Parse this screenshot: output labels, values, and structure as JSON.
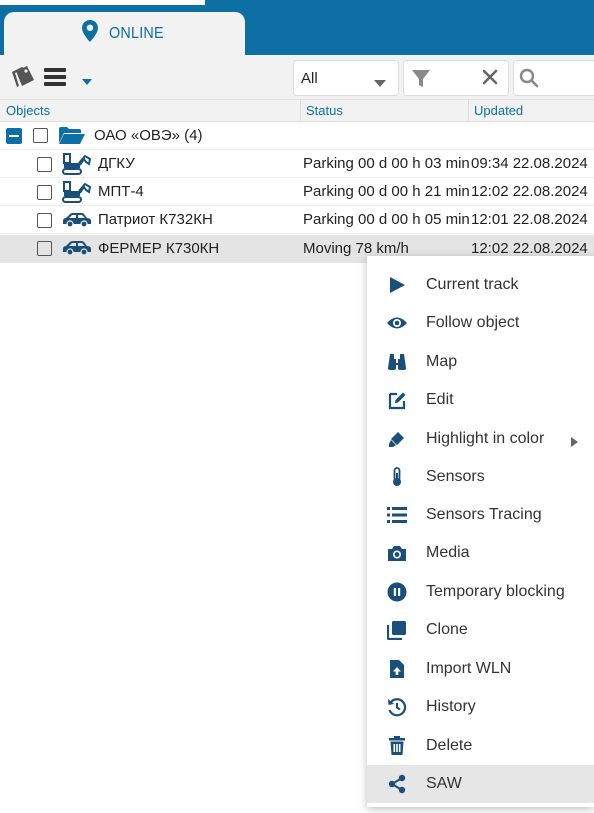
{
  "header": {
    "tab_label": "ONLINE"
  },
  "toolbar": {
    "select_value": "All",
    "search_placeholder": ""
  },
  "table": {
    "columns": {
      "objects": "Objects",
      "status": "Status",
      "updated": "Updated"
    },
    "group": {
      "label": "ОАО «ОВЭ» (4)"
    },
    "rows": [
      {
        "name": "ДГКУ",
        "status": "Parking 00 d 00 h 03 min",
        "updated": "09:34 22.08.2024",
        "icon": "excavator-icon"
      },
      {
        "name": "МПТ-4",
        "status": "Parking 00 d 00 h 21 min",
        "updated": "12:02 22.08.2024",
        "icon": "excavator-icon"
      },
      {
        "name": "Патриот К732КН",
        "status": "Parking 00 d 00 h 05 min",
        "updated": "12:01 22.08.2024",
        "icon": "car-icon"
      },
      {
        "name": "ФЕРМЕР К730КН",
        "status": "Moving 78 km/h",
        "updated": "12:02 22.08.2024",
        "icon": "car-icon"
      }
    ]
  },
  "context_menu": {
    "items": [
      {
        "label": "Current track",
        "icon": "play-icon"
      },
      {
        "label": "Follow object",
        "icon": "eye-icon"
      },
      {
        "label": "Map",
        "icon": "binoculars-icon"
      },
      {
        "label": "Edit",
        "icon": "edit-icon"
      },
      {
        "label": "Highlight in color",
        "icon": "marker-icon"
      },
      {
        "label": "Sensors",
        "icon": "thermometer-icon"
      },
      {
        "label": "Sensors Tracing",
        "icon": "list-icon"
      },
      {
        "label": "Media",
        "icon": "camera-icon"
      },
      {
        "label": "Temporary blocking",
        "icon": "pause-circle-icon"
      },
      {
        "label": "Clone",
        "icon": "clone-icon"
      },
      {
        "label": "Import WLN",
        "icon": "file-upload-icon"
      },
      {
        "label": "History",
        "icon": "history-icon"
      },
      {
        "label": "Delete",
        "icon": "trash-icon"
      },
      {
        "label": "SAW",
        "icon": "share-icon"
      }
    ]
  },
  "colors": {
    "accent": "#0e6fa5",
    "icon": "#1a4f7a",
    "selected_row": "#e4e4e4",
    "hover_item": "#e6e6e6"
  }
}
